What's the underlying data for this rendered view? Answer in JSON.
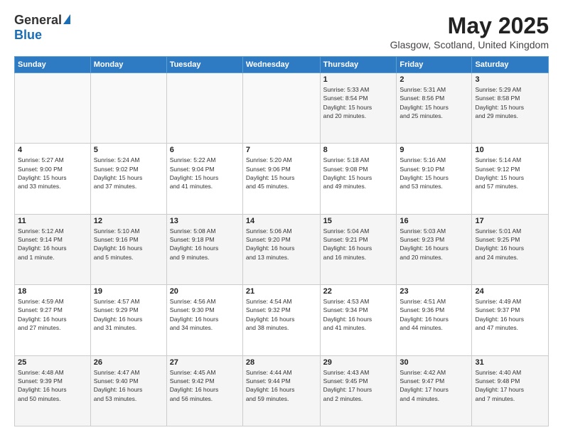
{
  "logo": {
    "general": "General",
    "blue": "Blue"
  },
  "header": {
    "month": "May 2025",
    "location": "Glasgow, Scotland, United Kingdom"
  },
  "weekdays": [
    "Sunday",
    "Monday",
    "Tuesday",
    "Wednesday",
    "Thursday",
    "Friday",
    "Saturday"
  ],
  "weeks": [
    [
      {
        "day": "",
        "info": ""
      },
      {
        "day": "",
        "info": ""
      },
      {
        "day": "",
        "info": ""
      },
      {
        "day": "",
        "info": ""
      },
      {
        "day": "1",
        "info": "Sunrise: 5:33 AM\nSunset: 8:54 PM\nDaylight: 15 hours\nand 20 minutes."
      },
      {
        "day": "2",
        "info": "Sunrise: 5:31 AM\nSunset: 8:56 PM\nDaylight: 15 hours\nand 25 minutes."
      },
      {
        "day": "3",
        "info": "Sunrise: 5:29 AM\nSunset: 8:58 PM\nDaylight: 15 hours\nand 29 minutes."
      }
    ],
    [
      {
        "day": "4",
        "info": "Sunrise: 5:27 AM\nSunset: 9:00 PM\nDaylight: 15 hours\nand 33 minutes."
      },
      {
        "day": "5",
        "info": "Sunrise: 5:24 AM\nSunset: 9:02 PM\nDaylight: 15 hours\nand 37 minutes."
      },
      {
        "day": "6",
        "info": "Sunrise: 5:22 AM\nSunset: 9:04 PM\nDaylight: 15 hours\nand 41 minutes."
      },
      {
        "day": "7",
        "info": "Sunrise: 5:20 AM\nSunset: 9:06 PM\nDaylight: 15 hours\nand 45 minutes."
      },
      {
        "day": "8",
        "info": "Sunrise: 5:18 AM\nSunset: 9:08 PM\nDaylight: 15 hours\nand 49 minutes."
      },
      {
        "day": "9",
        "info": "Sunrise: 5:16 AM\nSunset: 9:10 PM\nDaylight: 15 hours\nand 53 minutes."
      },
      {
        "day": "10",
        "info": "Sunrise: 5:14 AM\nSunset: 9:12 PM\nDaylight: 15 hours\nand 57 minutes."
      }
    ],
    [
      {
        "day": "11",
        "info": "Sunrise: 5:12 AM\nSunset: 9:14 PM\nDaylight: 16 hours\nand 1 minute."
      },
      {
        "day": "12",
        "info": "Sunrise: 5:10 AM\nSunset: 9:16 PM\nDaylight: 16 hours\nand 5 minutes."
      },
      {
        "day": "13",
        "info": "Sunrise: 5:08 AM\nSunset: 9:18 PM\nDaylight: 16 hours\nand 9 minutes."
      },
      {
        "day": "14",
        "info": "Sunrise: 5:06 AM\nSunset: 9:20 PM\nDaylight: 16 hours\nand 13 minutes."
      },
      {
        "day": "15",
        "info": "Sunrise: 5:04 AM\nSunset: 9:21 PM\nDaylight: 16 hours\nand 16 minutes."
      },
      {
        "day": "16",
        "info": "Sunrise: 5:03 AM\nSunset: 9:23 PM\nDaylight: 16 hours\nand 20 minutes."
      },
      {
        "day": "17",
        "info": "Sunrise: 5:01 AM\nSunset: 9:25 PM\nDaylight: 16 hours\nand 24 minutes."
      }
    ],
    [
      {
        "day": "18",
        "info": "Sunrise: 4:59 AM\nSunset: 9:27 PM\nDaylight: 16 hours\nand 27 minutes."
      },
      {
        "day": "19",
        "info": "Sunrise: 4:57 AM\nSunset: 9:29 PM\nDaylight: 16 hours\nand 31 minutes."
      },
      {
        "day": "20",
        "info": "Sunrise: 4:56 AM\nSunset: 9:30 PM\nDaylight: 16 hours\nand 34 minutes."
      },
      {
        "day": "21",
        "info": "Sunrise: 4:54 AM\nSunset: 9:32 PM\nDaylight: 16 hours\nand 38 minutes."
      },
      {
        "day": "22",
        "info": "Sunrise: 4:53 AM\nSunset: 9:34 PM\nDaylight: 16 hours\nand 41 minutes."
      },
      {
        "day": "23",
        "info": "Sunrise: 4:51 AM\nSunset: 9:36 PM\nDaylight: 16 hours\nand 44 minutes."
      },
      {
        "day": "24",
        "info": "Sunrise: 4:49 AM\nSunset: 9:37 PM\nDaylight: 16 hours\nand 47 minutes."
      }
    ],
    [
      {
        "day": "25",
        "info": "Sunrise: 4:48 AM\nSunset: 9:39 PM\nDaylight: 16 hours\nand 50 minutes."
      },
      {
        "day": "26",
        "info": "Sunrise: 4:47 AM\nSunset: 9:40 PM\nDaylight: 16 hours\nand 53 minutes."
      },
      {
        "day": "27",
        "info": "Sunrise: 4:45 AM\nSunset: 9:42 PM\nDaylight: 16 hours\nand 56 minutes."
      },
      {
        "day": "28",
        "info": "Sunrise: 4:44 AM\nSunset: 9:44 PM\nDaylight: 16 hours\nand 59 minutes."
      },
      {
        "day": "29",
        "info": "Sunrise: 4:43 AM\nSunset: 9:45 PM\nDaylight: 17 hours\nand 2 minutes."
      },
      {
        "day": "30",
        "info": "Sunrise: 4:42 AM\nSunset: 9:47 PM\nDaylight: 17 hours\nand 4 minutes."
      },
      {
        "day": "31",
        "info": "Sunrise: 4:40 AM\nSunset: 9:48 PM\nDaylight: 17 hours\nand 7 minutes."
      }
    ]
  ]
}
